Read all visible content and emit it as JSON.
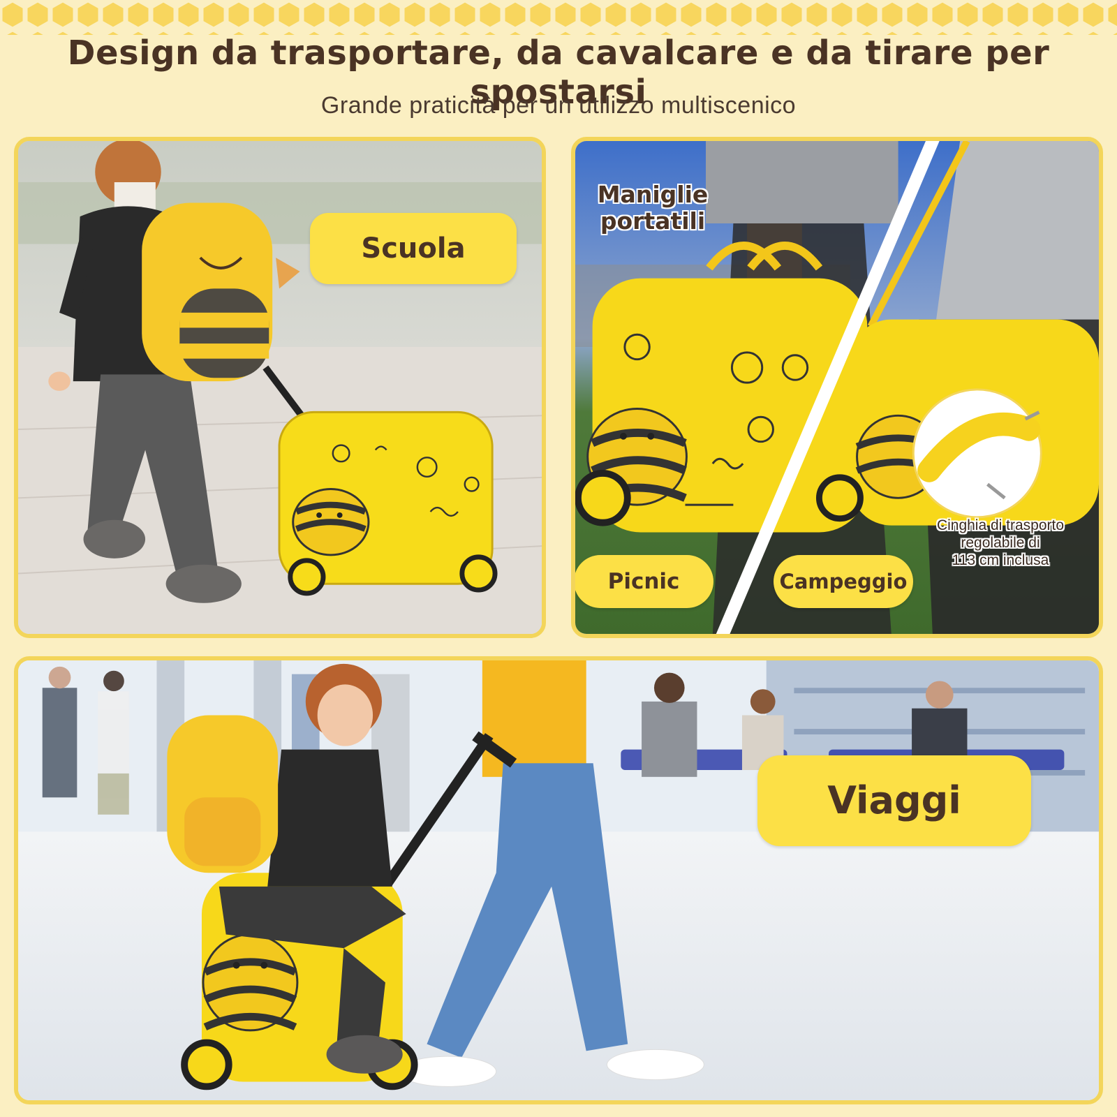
{
  "header": {
    "title": "Design da trasportare, da cavalcare e da tirare per spostarsi",
    "subtitle": "Grande praticità per un utilizzo multiscenico"
  },
  "panels": {
    "school": {
      "label": "Scuola"
    },
    "carry": {
      "handles_callout_line1": "Maniglie",
      "handles_callout_line2": "portatili",
      "picnic_label": "Picnic",
      "camping_label": "Campeggio",
      "strap_callout_line1": "Cinghia di trasporto",
      "strap_callout_line2": "regolabile di",
      "strap_callout_line3": "113 cm inclusa"
    },
    "travel": {
      "label": "Viaggi"
    }
  },
  "colors": {
    "background": "#fbefc2",
    "accent_yellow": "#fce046",
    "panel_border": "#f3d55a",
    "text_brown": "#4a3324"
  }
}
